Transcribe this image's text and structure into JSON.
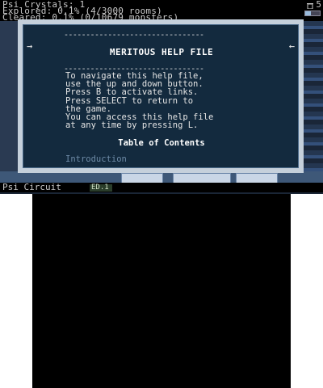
{
  "hud": {
    "line1": "Psi Crystals: 1",
    "line2": "Explored: 0.1% (4/3000 rooms)",
    "line3": "Cleared: 0.1% (0/10679 monsters)",
    "right_value": "5",
    "right_icon": "trash-icon"
  },
  "dialog": {
    "rule_top": "--------------------------------",
    "title": "MERITOUS HELP FILE",
    "rule_bottom": "--------------------------------",
    "body": "To navigate this help file,\nuse the up and down button.\nPress B to activate links.\nPress SELECT to return to\nthe game.\nYou can access this help file\nat any time by pressing L.",
    "toc_heading": "Table of Contents",
    "link_intro": "Introduction",
    "arrow_left": "→",
    "arrow_right": "←"
  },
  "bottom": {
    "title": "Psi Circuit",
    "badge": "ED.1"
  },
  "colors": {
    "dialog_bg": "#132a3e",
    "dialog_frame": "#c5d0db",
    "link": "#6d8aa6"
  }
}
